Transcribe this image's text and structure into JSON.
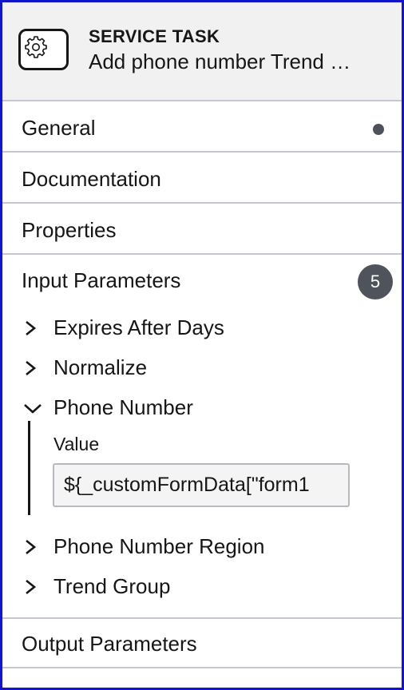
{
  "header": {
    "type_label": "SERVICE TASK",
    "name": "Add phone number Trend …",
    "icon": "gear-icon"
  },
  "groups": {
    "general": {
      "label": "General",
      "indicator": "dot"
    },
    "documentation": {
      "label": "Documentation"
    },
    "properties": {
      "label": "Properties"
    },
    "input_parameters": {
      "label": "Input Parameters",
      "count": "5",
      "items": [
        {
          "label": "Expires After Days",
          "expanded": false
        },
        {
          "label": "Normalize",
          "expanded": false
        },
        {
          "label": "Phone Number",
          "expanded": true,
          "value_label": "Value",
          "value": "${_customFormData[\"form1"
        },
        {
          "label": "Phone Number Region",
          "expanded": false
        },
        {
          "label": "Trend Group",
          "expanded": false
        }
      ]
    },
    "output_parameters": {
      "label": "Output Parameters"
    }
  },
  "colors": {
    "frame_border": "#1414c8",
    "header_bg": "#f1f1f1",
    "badge_bg": "#4f535c",
    "divider": "#c6c6d4"
  }
}
